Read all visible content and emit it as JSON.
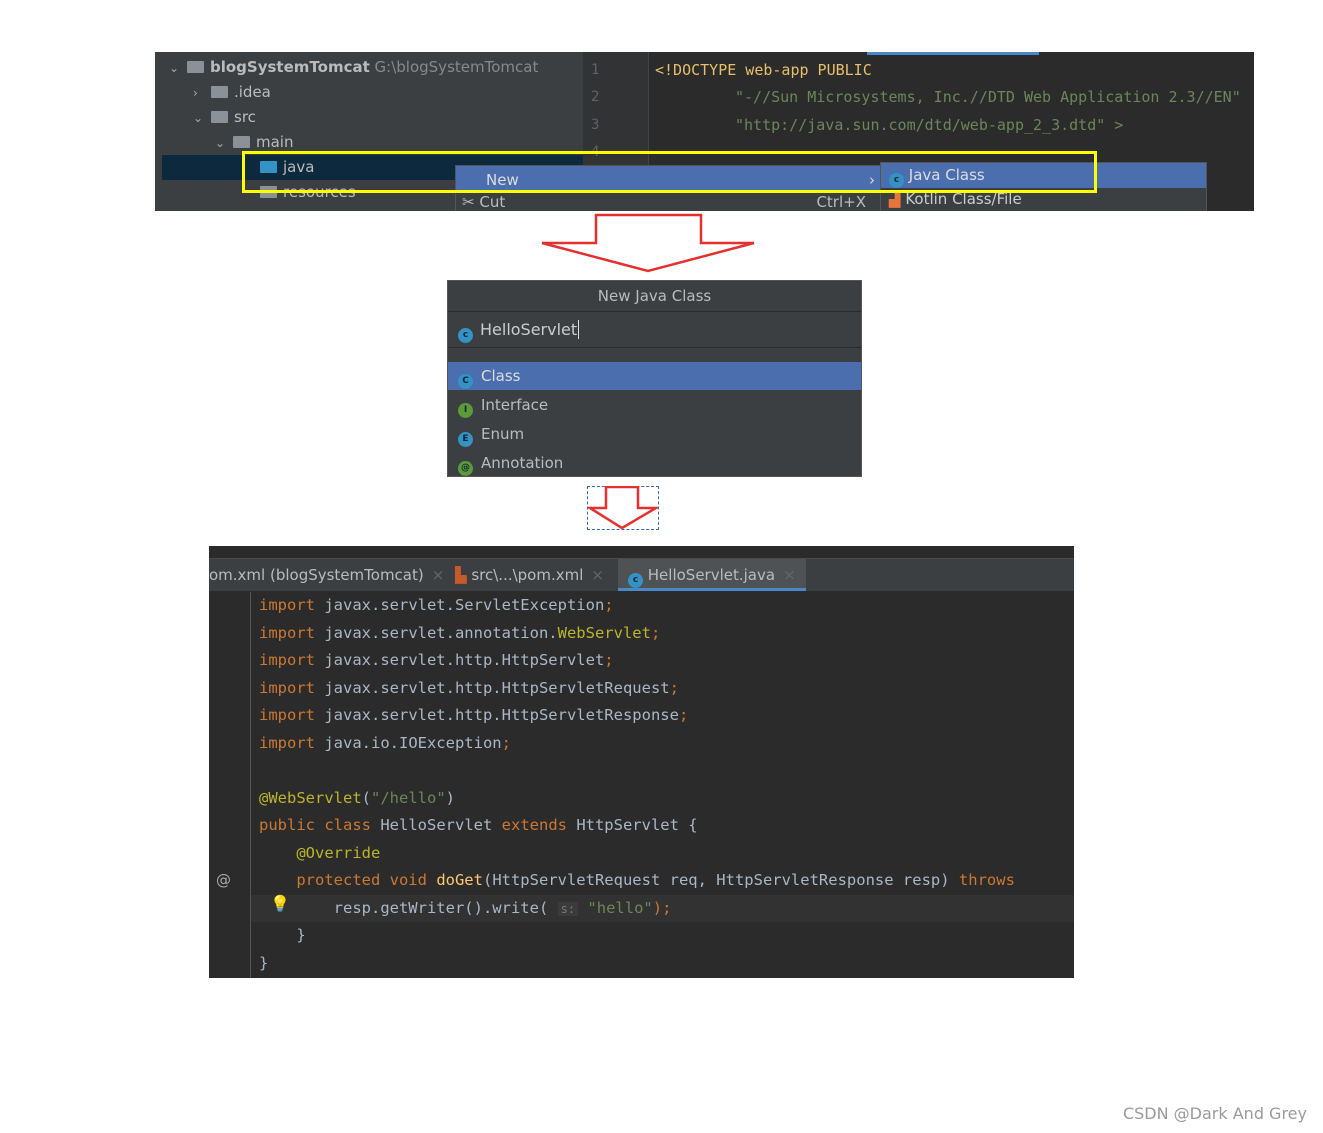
{
  "top": {
    "tree": [
      {
        "label": "blogSystemTomcat",
        "path": "G:\\blogSystemTomcat",
        "chev": "⌄"
      },
      {
        "label": ".idea",
        "chev": "›"
      },
      {
        "label": "src",
        "chev": "⌄"
      },
      {
        "label": "main",
        "chev": "⌄"
      },
      {
        "label": "java",
        "chev": ""
      },
      {
        "label": "resources",
        "chev": ""
      }
    ],
    "line_numbers": [
      "1",
      "2",
      "3",
      "4"
    ],
    "code": [
      "<!DOCTYPE web-app PUBLIC",
      "\"-//Sun Microsystems, Inc.//DTD Web Application 2.3//EN\"",
      "\"http://java.sun.com/dtd/web-app_2_3.dtd\" >"
    ],
    "menu": {
      "new": "New",
      "cut": "Cut",
      "cut_shortcut": "Ctrl+X"
    },
    "submenu": {
      "java_class": "Java Class",
      "kotlin": "Kotlin Class/File"
    }
  },
  "dialog": {
    "title": "New Java Class",
    "name_value": "HelloServlet",
    "options": [
      {
        "label": "Class",
        "letter": "C",
        "color": "#3592c4"
      },
      {
        "label": "Interface",
        "letter": "I",
        "color": "#5c9a3a"
      },
      {
        "label": "Enum",
        "letter": "E",
        "color": "#3592c4"
      },
      {
        "label": "Annotation",
        "letter": "@",
        "color": "#5c9a3a"
      }
    ]
  },
  "editor": {
    "tabs": [
      "om.xml (blogSystemTomcat)",
      "src\\...\\pom.xml",
      "HelloServlet.java"
    ],
    "lines": [
      [
        [
          "import ",
          "kw"
        ],
        [
          "javax.servlet.ServletException",
          "txt"
        ],
        [
          ";",
          "kw"
        ]
      ],
      [
        [
          "import ",
          "kw"
        ],
        [
          "javax.servlet.annotation.",
          "txt"
        ],
        [
          "WebServlet",
          "ann"
        ],
        [
          ";",
          "kw"
        ]
      ],
      [
        [
          "import ",
          "kw"
        ],
        [
          "javax.servlet.http.HttpServlet",
          "txt"
        ],
        [
          ";",
          "kw"
        ]
      ],
      [
        [
          "import ",
          "kw"
        ],
        [
          "javax.servlet.http.HttpServletRequest",
          "txt"
        ],
        [
          ";",
          "kw"
        ]
      ],
      [
        [
          "import ",
          "kw"
        ],
        [
          "javax.servlet.http.HttpServletResponse",
          "txt"
        ],
        [
          ";",
          "kw"
        ]
      ],
      [
        [
          "import ",
          "kw"
        ],
        [
          "java.io.IOException",
          "txt"
        ],
        [
          ";",
          "kw"
        ]
      ],
      [],
      [
        [
          "@WebServlet",
          "ann"
        ],
        [
          "(",
          "txt"
        ],
        [
          "\"/hello\"",
          "str"
        ],
        [
          ")",
          "txt"
        ]
      ],
      [
        [
          "public class ",
          "kw"
        ],
        [
          "HelloServlet ",
          "txt"
        ],
        [
          "extends ",
          "kw"
        ],
        [
          "HttpServlet {",
          "txt"
        ]
      ],
      [
        [
          "    @Override",
          "ann"
        ]
      ],
      [
        [
          "    protected void ",
          "kw"
        ],
        [
          "doGet",
          "mth"
        ],
        [
          "(HttpServletRequest req, HttpServletResponse resp) ",
          "txt"
        ],
        [
          "throws",
          "kw"
        ]
      ],
      [
        [
          "        resp.getWriter().write( ",
          "txt"
        ],
        [
          "s:",
          "hint"
        ],
        [
          " ",
          "txt"
        ],
        [
          "\"hello\"",
          "str"
        ],
        [
          ");",
          "kw"
        ]
      ],
      [
        [
          "    }",
          "txt"
        ]
      ],
      [
        [
          "}",
          "txt"
        ]
      ]
    ]
  },
  "watermark": "CSDN @Dark And Grey"
}
